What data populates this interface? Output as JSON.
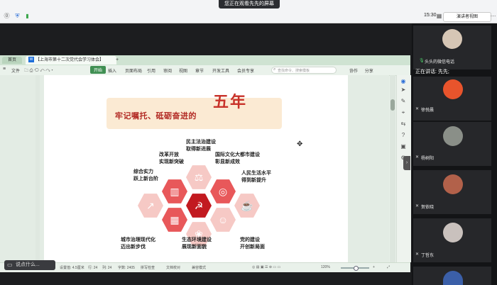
{
  "meeting": {
    "share_banner": "您正在观看先先的屏幕",
    "time": "15:30",
    "view_button": "演讲者视图",
    "speaking": "正在讲话: 先先;"
  },
  "wps": {
    "home_tab": "首页",
    "doc_tab": "【上海市第十二次党代会学习体会】",
    "menus": [
      "文件",
      "开始",
      "插入",
      "页面布局",
      "引用",
      "审阅",
      "视图",
      "章节",
      "开发工具",
      "会员专享"
    ],
    "search_placeholder": "查找命令、搜索模板",
    "ribbon_extra": [
      "协作",
      "分享"
    ],
    "status": {
      "page": "页面: 1/1",
      "words": "字数: 2405",
      "spell": "拼写检查",
      "proof": "文档校对",
      "compat": "兼容模式",
      "settings": "设置值: 4.5厘米",
      "line": "行: 24",
      "col": "列: 24",
      "zoom": "120%"
    },
    "chat_placeholder": "说点什么..."
  },
  "document": {
    "banner_title": "牢记嘱托、砥砺奋进的",
    "banner_big": "五年",
    "items": {
      "legal": [
        "民主法治建设",
        "取得新进展"
      ],
      "reform": [
        "改革开放",
        "实现新突破"
      ],
      "economy": [
        "综合实力",
        "跃上新台阶"
      ],
      "culture": [
        "国际文化大都市建设",
        "彰显新成效"
      ],
      "livelihood": [
        "人民生活水平",
        "得到新提升"
      ],
      "governance": [
        "城市治理现代化",
        "迈出新步伐"
      ],
      "ecology": [
        "生态环境建设",
        "展现新面貌"
      ],
      "party": [
        "党的建设",
        "开创新局面"
      ]
    }
  },
  "participants": [
    {
      "name": "头头的微信电话"
    },
    {
      "name": "徐悦晨"
    },
    {
      "name": "杨树阳"
    },
    {
      "name": "贺依晓"
    },
    {
      "name": "丁哲东"
    }
  ]
}
